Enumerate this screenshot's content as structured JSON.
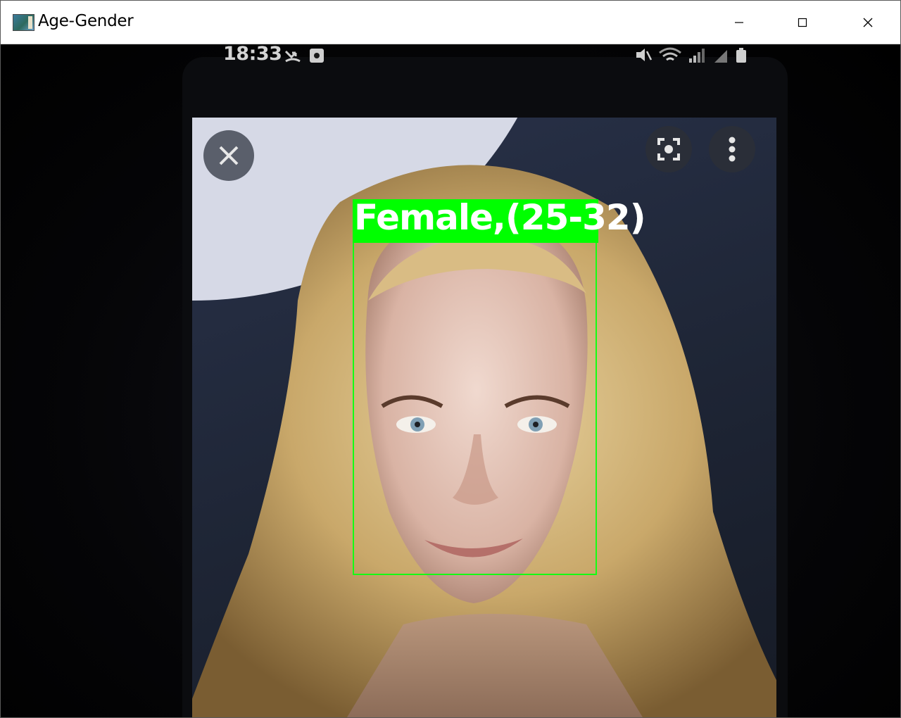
{
  "window": {
    "title": "Age-Gender",
    "controls": {
      "minimize": "minimize-icon",
      "maximize": "maximize-icon",
      "close": "close-icon"
    }
  },
  "camera_feed": {
    "phone_status_time": "18:33",
    "detection": {
      "label": "Female,(25-32)",
      "box_color": "#00ff00",
      "text_color": "#ffffff"
    }
  },
  "colors": {
    "titlebar_bg": "#ffffff",
    "frame_bg": "#000000",
    "detection_green": "#00ff00"
  }
}
